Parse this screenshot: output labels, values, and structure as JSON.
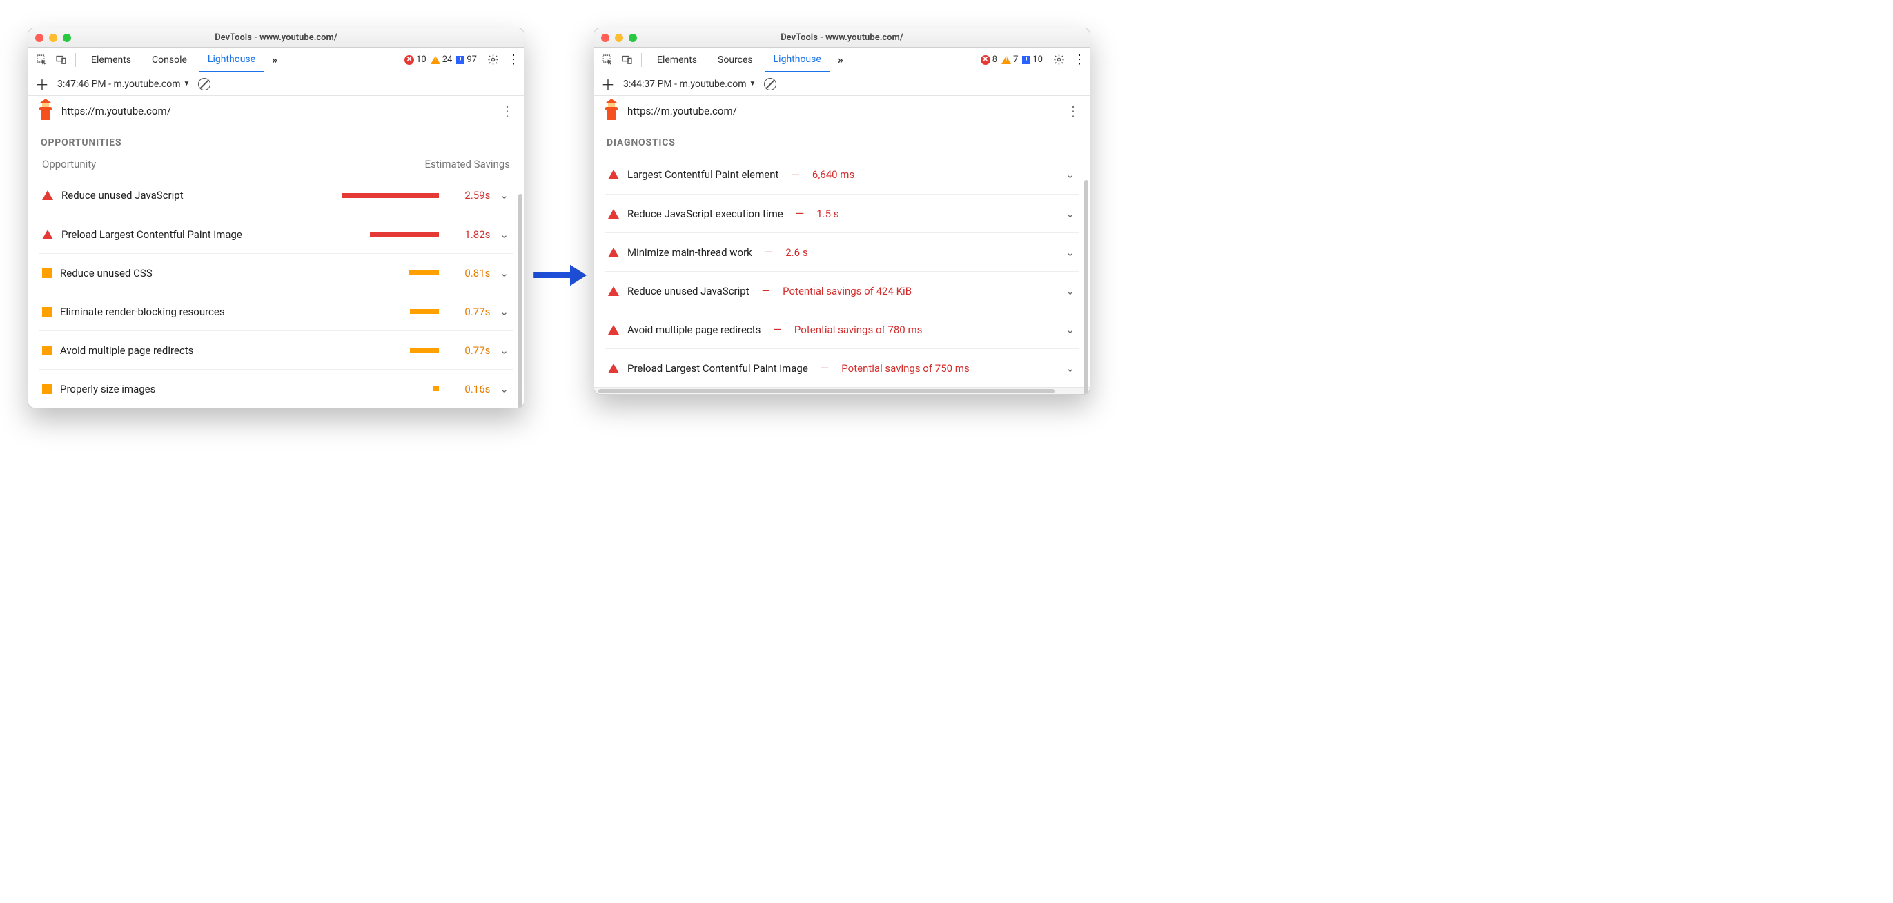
{
  "left": {
    "title": "DevTools - www.youtube.com/",
    "tabs": [
      "Elements",
      "Console",
      "Lighthouse"
    ],
    "active_tab": "Lighthouse",
    "badges": {
      "errors": "10",
      "warnings": "24",
      "info": "97"
    },
    "report_time": "3:47:46 PM - m.youtube.com",
    "url": "https://m.youtube.com/",
    "section": "OPPORTUNITIES",
    "col_left": "Opportunity",
    "col_right": "Estimated Savings",
    "audits": [
      {
        "severity": "tri",
        "label": "Reduce unused JavaScript",
        "bar": "red",
        "barw": 140,
        "sav": "2.59s",
        "savc": "red"
      },
      {
        "severity": "tri",
        "label": "Preload Largest Contentful Paint image",
        "bar": "red",
        "barw": 100,
        "sav": "1.82s",
        "savc": "red"
      },
      {
        "severity": "sq",
        "label": "Reduce unused CSS",
        "bar": "org",
        "barw": 44,
        "sav": "0.81s",
        "savc": "org"
      },
      {
        "severity": "sq",
        "label": "Eliminate render-blocking resources",
        "bar": "org",
        "barw": 42,
        "sav": "0.77s",
        "savc": "org"
      },
      {
        "severity": "sq",
        "label": "Avoid multiple page redirects",
        "bar": "org",
        "barw": 42,
        "sav": "0.77s",
        "savc": "org"
      },
      {
        "severity": "sq",
        "label": "Properly size images",
        "bar": "org",
        "barw": 9,
        "sav": "0.16s",
        "savc": "org"
      }
    ]
  },
  "right": {
    "title": "DevTools - www.youtube.com/",
    "tabs": [
      "Elements",
      "Sources",
      "Lighthouse"
    ],
    "active_tab": "Lighthouse",
    "badges": {
      "errors": "8",
      "warnings": "7",
      "info": "10"
    },
    "report_time": "3:44:37 PM - m.youtube.com",
    "url": "https://m.youtube.com/",
    "section": "DIAGNOSTICS",
    "audits": [
      {
        "label": "Largest Contentful Paint element",
        "metric": "6,640 ms"
      },
      {
        "label": "Reduce JavaScript execution time",
        "metric": "1.5 s"
      },
      {
        "label": "Minimize main-thread work",
        "metric": "2.6 s"
      },
      {
        "label": "Reduce unused JavaScript",
        "metric": "Potential savings of 424 KiB"
      },
      {
        "label": "Avoid multiple page redirects",
        "metric": "Potential savings of 780 ms"
      },
      {
        "label": "Preload Largest Contentful Paint image",
        "metric": "Potential savings of 750 ms"
      }
    ]
  }
}
